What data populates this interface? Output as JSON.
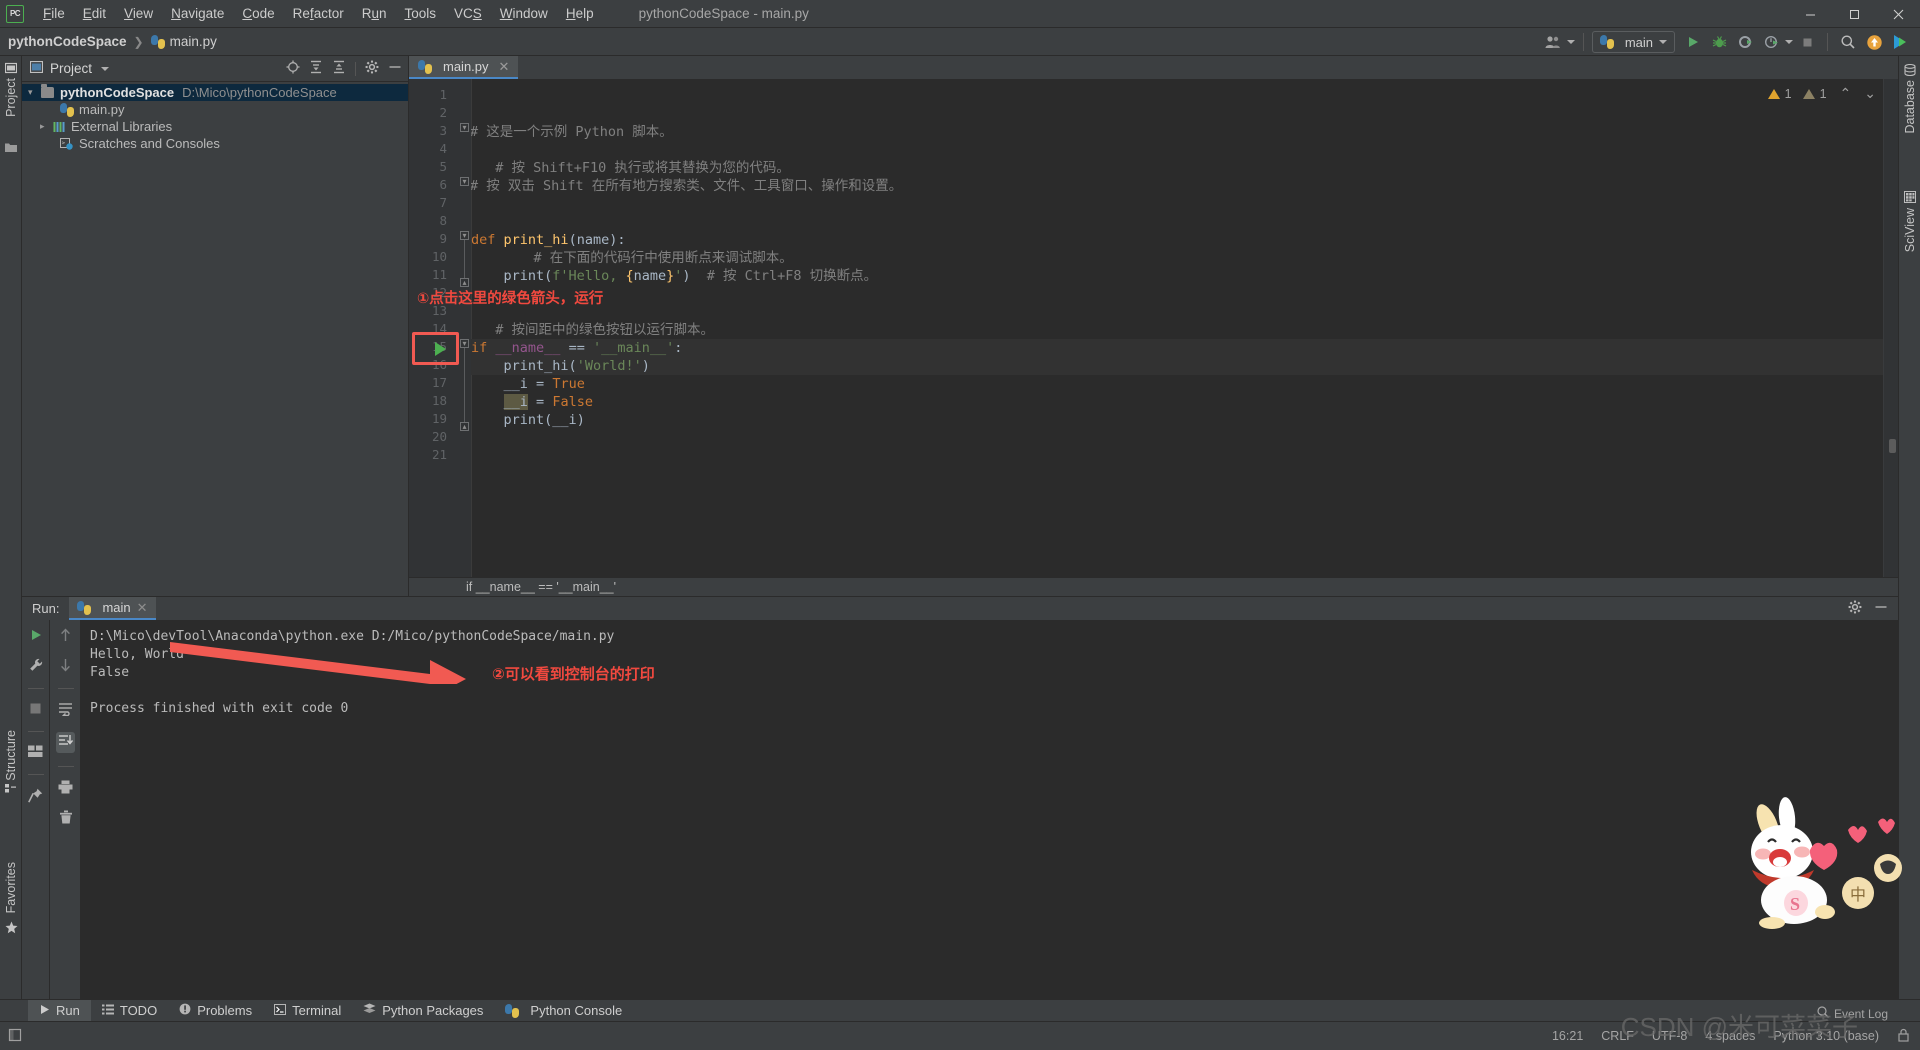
{
  "window": {
    "title": "pythonCodeSpace - main.py",
    "minimize": "—",
    "maximize": "❐",
    "close": "✕"
  },
  "menu": {
    "items": [
      "File",
      "Edit",
      "View",
      "Navigate",
      "Code",
      "Refactor",
      "Run",
      "Tools",
      "VCS",
      "Window",
      "Help"
    ]
  },
  "navbar": {
    "breadcrumb_project": "pythonCodeSpace",
    "breadcrumb_file": "main.py",
    "run_config": "main",
    "icons": {
      "profile": "user-group-icon",
      "run": "run-icon",
      "debug": "debug-icon",
      "coverage": "coverage-icon",
      "profiler": "profiler-icon",
      "stop": "stop-icon",
      "search": "search-icon",
      "update": "update-icon",
      "ide": "ide-icon"
    }
  },
  "left_stripe": {
    "project_label": "Project",
    "structure_label": "Structure",
    "favorites_label": "Favorites"
  },
  "right_stripe": {
    "database_label": "Database",
    "sciview_label": "SciView"
  },
  "project_panel": {
    "title": "Project",
    "tree": [
      {
        "label": "pythonCodeSpace",
        "path": "D:\\Mico\\pythonCodeSpace",
        "kind": "project-root",
        "selected": true,
        "expanded": true,
        "indent": 0
      },
      {
        "label": "main.py",
        "path": "",
        "kind": "python-file",
        "selected": false,
        "expanded": false,
        "indent": 1
      },
      {
        "label": "External Libraries",
        "path": "",
        "kind": "libraries",
        "selected": false,
        "expanded": false,
        "indent": 0
      },
      {
        "label": "Scratches and Consoles",
        "path": "",
        "kind": "scratches",
        "selected": false,
        "expanded": false,
        "indent": 0
      }
    ]
  },
  "editor": {
    "tab_name": "main.py",
    "tab_close": "✕",
    "inspections": {
      "warnings": "1",
      "weak_warnings": "1",
      "up": "⌃",
      "down": "⌄"
    },
    "breadcrumb": "if __name__ == '__main__'",
    "lines": [
      {
        "n": "1",
        "content": ""
      },
      {
        "n": "2",
        "content": ""
      },
      {
        "n": "3",
        "content": "# 这是一个示例 Python 脚本。"
      },
      {
        "n": "4",
        "content": ""
      },
      {
        "n": "5",
        "content": "  # 按 Shift+F10 执行或将其替换为您的代码。"
      },
      {
        "n": "6",
        "content": "# 按 双击 Shift 在所有地方搜索类、文件、工具窗口、操作和设置。"
      },
      {
        "n": "7",
        "content": ""
      },
      {
        "n": "8",
        "content": ""
      },
      {
        "n": "9",
        "content": "def print_hi(name):"
      },
      {
        "n": "10",
        "content": "    # 在下面的代码行中使用断点来调试脚本。"
      },
      {
        "n": "11",
        "content": "    print(f'Hello, {name}')  # 按 Ctrl+F8 切换断点。"
      },
      {
        "n": "12",
        "content": ""
      },
      {
        "n": "13",
        "content": ""
      },
      {
        "n": "14",
        "content": "  # 按间距中的绿色按钮以运行脚本。"
      },
      {
        "n": "15",
        "content": "if __name__ == '__main__':"
      },
      {
        "n": "16",
        "content": "    print_hi('World!')"
      },
      {
        "n": "17",
        "content": "    __i = True"
      },
      {
        "n": "18",
        "content": "    __i = False"
      },
      {
        "n": "19",
        "content": "    print(__i)"
      },
      {
        "n": "20",
        "content": ""
      },
      {
        "n": "21",
        "content": ""
      }
    ]
  },
  "annotations": {
    "note1": "①点击这里的绿色箭头，运行",
    "note2": "②可以看到控制台的打印",
    "color": "#f1493f"
  },
  "run_panel": {
    "label": "Run:",
    "tab_name": "main",
    "tab_close": "✕",
    "console_lines": [
      "D:\\Mico\\devTool\\Anaconda\\python.exe D:/Mico/pythonCodeSpace/main.py",
      "Hello, World",
      "False",
      "",
      "Process finished with exit code 0"
    ],
    "tool_icons": [
      "rerun-icon",
      "wrench-icon",
      "stop-icon",
      "layout-icon",
      "pin-icon"
    ],
    "tool_icons2": [
      "scroll-up-icon",
      "scroll-down-icon",
      "soft-wrap-icon",
      "scroll-to-end-icon",
      "print-icon",
      "trash-icon"
    ],
    "settings_icon": "gear-icon",
    "hide_icon": "minimize-icon"
  },
  "bottom_bar": {
    "items": [
      {
        "label": "Run",
        "icon": "run-icon",
        "active": true
      },
      {
        "label": "TODO",
        "icon": "todo-icon",
        "active": false
      },
      {
        "label": "Problems",
        "icon": "problems-icon",
        "active": false
      },
      {
        "label": "Terminal",
        "icon": "terminal-icon",
        "active": false
      },
      {
        "label": "Python Packages",
        "icon": "packages-icon",
        "active": false
      },
      {
        "label": "Python Console",
        "icon": "python-console-icon",
        "active": false
      }
    ]
  },
  "status_bar": {
    "event_log": "Event Log",
    "time": "16:21",
    "line_sep": "CRLF",
    "encoding": "UTF-8",
    "indent": "4 spaces",
    "interpreter": "Python 3.10 (base)"
  },
  "watermark": "CSDN @米可菜菜子"
}
